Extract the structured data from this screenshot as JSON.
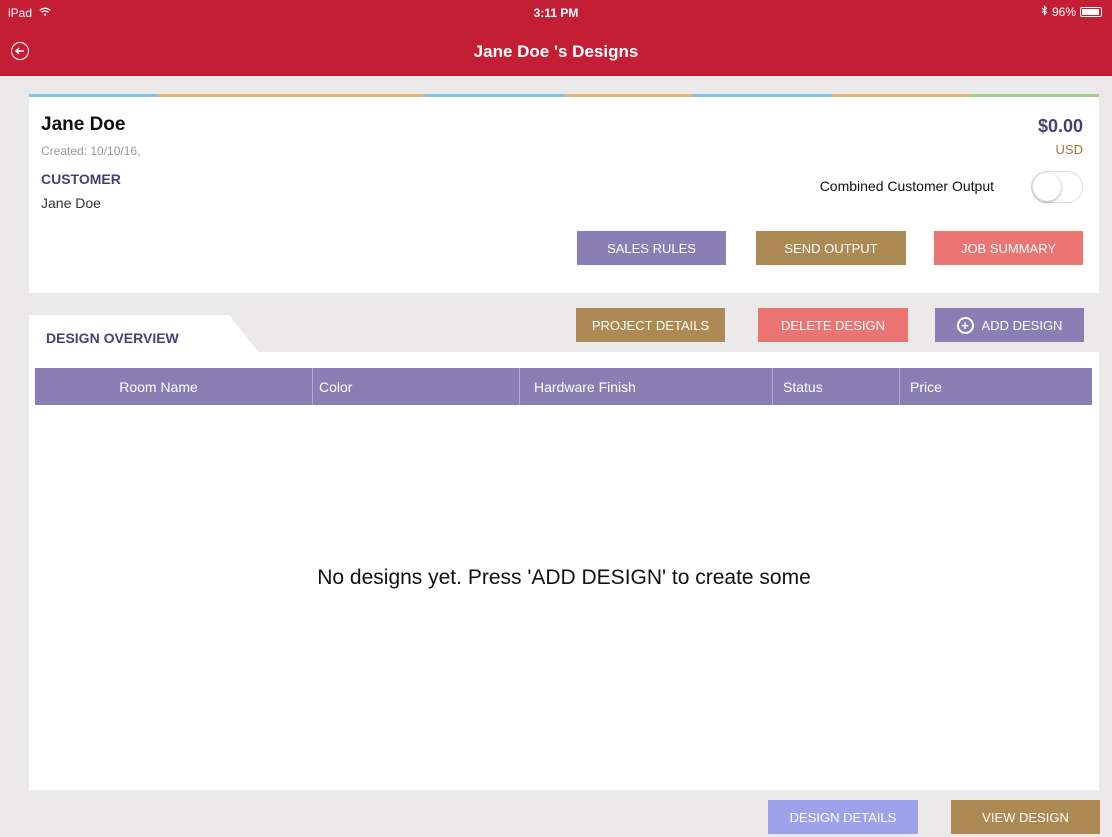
{
  "status_bar": {
    "device": "iPad",
    "time": "3:11 PM",
    "battery": "96%",
    "bluetooth_icon": "bluetooth-icon",
    "wifi_icon": "wifi-icon"
  },
  "nav": {
    "title": "Jane Doe 's Designs",
    "back_icon": "back-arrow-icon"
  },
  "customer": {
    "name": "Jane Doe",
    "created": "Created: 10/10/16,",
    "label": "CUSTOMER",
    "value": "Jane Doe",
    "amount": "$0.00",
    "currency": "USD",
    "combined_output_label": "Combined Customer Output",
    "combined_output_on": false
  },
  "actions": {
    "sales_rules": "SALES RULES",
    "send_output": "SEND OUTPUT",
    "job_summary": "JOB SUMMARY",
    "project_details": "PROJECT DETAILS",
    "delete_design": "DELETE DESIGN",
    "add_design": "ADD DESIGN",
    "design_details": "DESIGN DETAILS",
    "view_design": "VIEW DESIGN"
  },
  "overview": {
    "tab_label": "DESIGN OVERVIEW",
    "columns": [
      "Room Name",
      "Color",
      "Hardware Finish",
      "Status",
      "Price"
    ],
    "empty_message": "No designs yet. Press 'ADD DESIGN' to create some"
  },
  "colors": {
    "nav_red": "#c41e35",
    "purple": "#8a7fb4",
    "gold": "#ad8a53",
    "coral": "#ec7574",
    "light_purple": "#9fa2ea"
  }
}
